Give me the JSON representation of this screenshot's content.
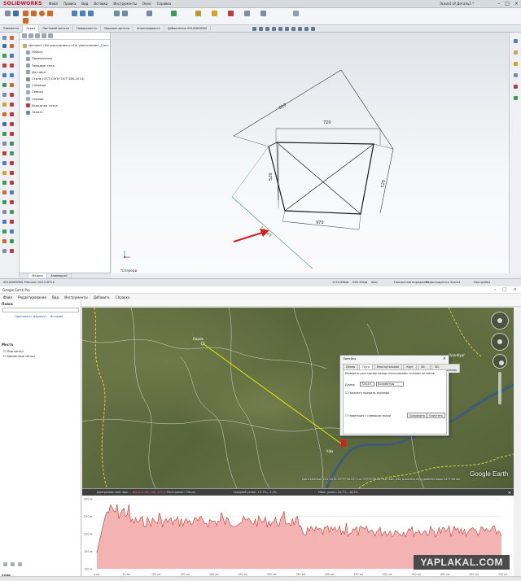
{
  "solidworks": {
    "logo": "SOLIDWORKS",
    "menu": [
      "Файл",
      "Правка",
      "Вид",
      "Вставка",
      "Инструменты",
      "Окно",
      "Справка"
    ],
    "doc_title": "Эскиз1 of Деталь1 *",
    "tabs": [
      "Элементы",
      "Эскиз",
      "Листовой металл",
      "Поверхности",
      "Сварные детали",
      "Анализировать",
      "Добавления SOLIDWORKS"
    ],
    "active_tab": "Эскиз",
    "feature_tree": [
      "Деталь1 (По умолчанию<<По умолчанию>_Сост...",
      "History",
      "Примечания",
      "Твердые тела",
      "Датчики",
      "Сталь (ОСТ/СНП/ГОСТ 380-2014)",
      "Спереди",
      "Сверху",
      "Справа",
      "Исходная точка",
      "Эскиз1"
    ],
    "bottom_tabs": [
      "Модель",
      "Анимация1"
    ],
    "active_bottom_tab": "Модель",
    "view_label": "*Спереди",
    "dimensions": {
      "top": "720",
      "diagonal_upper_left": "810",
      "left": "520",
      "right": "520",
      "bottom": "970",
      "measured_diagonal": "726.49"
    },
    "status": {
      "product": "SOLIDWORKS Premium 2014 SP0.0",
      "x": "1110.69мм",
      "y": "-900.95мм",
      "z": "0мм",
      "state": "Полностью определен",
      "sketch": "Редактируется Эскиз1",
      "custom": "Настройка"
    }
  },
  "google_earth": {
    "title": "Google Earth Pro",
    "menu": [
      "Файл",
      "Редактирование",
      "Вид",
      "Инструменты",
      "Добавить",
      "Справка"
    ],
    "search_header": "Поиск",
    "search_links": [
      "Проложить маршрут",
      "История"
    ],
    "places_header": "Места",
    "places": [
      "Мои метки",
      "Временные метки"
    ],
    "layers_header": "Слои",
    "ruler": {
      "title": "Линейка",
      "tabs": [
        "Линия",
        "Путь",
        "Многоугольник",
        "Круг",
        "3D-путь",
        "3D-многоугольник"
      ],
      "active_tab": "Путь",
      "description": "Измерить расстояние между несколькими точками на земле",
      "length_label": "Длина:",
      "length_value": "726,49",
      "unit": "Километры",
      "show_profile": "Показать профиль рельефа",
      "mouse_nav": "Навигация с помощью мыши",
      "save_button": "Сохранить",
      "clear_button": "Очистить"
    },
    "attribution": "Дата съемки: 12.1.2015   53°17'45.22\" с.ш.  59°53'08.34\" в.д.   выс. 281 м   высота над уровнем моря 1477.98 км",
    "logo": "Google Earth",
    "profile_info": [
      "Диаграмма: мин. выс.",
      "Высота: 81, 200, 305 м",
      "Расстояние: 726 км",
      "Средний уклон: +2.7%, -2.3%",
      "Макс. уклон: 18.7%, -18.5%"
    ],
    "profile_y_labels": [
      "300 м",
      "250 м",
      "200 м",
      "150 м",
      "100 м"
    ],
    "profile_x_labels": [
      "0 км",
      "50 км",
      "100 км",
      "150 км",
      "200 км",
      "250 км",
      "300 км",
      "350 км",
      "400 км",
      "450 км",
      "500 км",
      "550 км",
      "600 км",
      "650 км",
      "726 км"
    ],
    "pin_label": "Уфа",
    "map_label_right": "Оренбург",
    "map_label_top": "Киров"
  },
  "watermark": "YAPLAKAL.COM",
  "colors": {
    "sketch_line": "#1a1a1a",
    "dim_line": "#333333",
    "ref_line": "#2e8b57",
    "arrow": "#d62020",
    "profile_fill": "#f3b3b3",
    "profile_line": "#c0392b",
    "path_line": "#e6e600"
  }
}
